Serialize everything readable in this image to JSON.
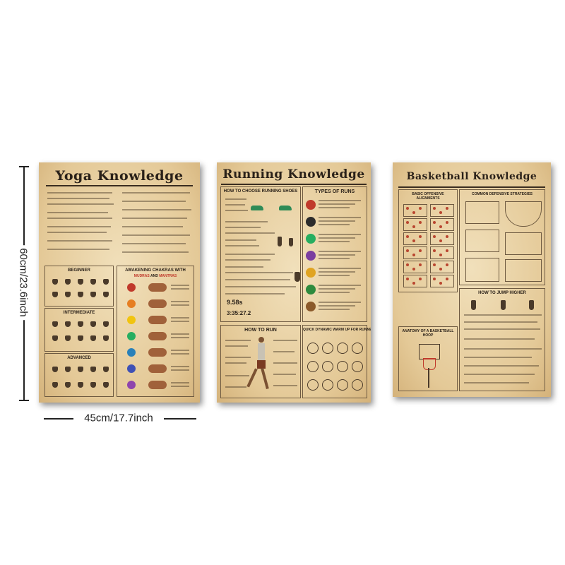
{
  "dimensions": {
    "height": "60cm/23.6inch",
    "width": "45cm/17.7inch"
  },
  "posters": {
    "yoga": {
      "title": "Yoga Knowledge",
      "sections": [
        "BEGINNER",
        "INTERMEDIATE",
        "ADVANCED"
      ],
      "chakras_title": "AWAKENING CHAKRAS WITH",
      "chakras_sub1": "MUDRAS",
      "chakras_and": "AND",
      "chakras_sub2": "MANTRAS"
    },
    "running": {
      "title": "Running Knowledge",
      "sections": {
        "shoes": "HOW TO CHOOSE RUNNING SHOES",
        "types": "TYPES OF RUNS",
        "how": "HOW TO RUN",
        "warmup": "QUICK DYNAMIC WARM UP FOR RUNNERS"
      },
      "stats": [
        "9.58s",
        "3:35:27.2"
      ]
    },
    "basketball": {
      "title": "Basketball Knowledge",
      "sections": {
        "offensive": "BASIC OFFENSIVE ALIGNMENTS",
        "defense": "COMMON DEFENSIVE STRATEGIES",
        "jump": "HOW TO JUMP HIGHER",
        "hoop": "ANATOMY OF A BASKETBALL HOOP"
      }
    }
  },
  "colors": {
    "paper": "#e9d3a6",
    "ink": "#2a2119",
    "chakras": [
      "#c0392b",
      "#e67e22",
      "#f1c40f",
      "#27ae60",
      "#2980b9",
      "#3f51b5",
      "#8e44ad"
    ],
    "runs": [
      "#c0392b",
      "#2c2c2c",
      "#27ae60",
      "#7b3fa0",
      "#e0a422",
      "#2e8b3e",
      "#8b5a2b"
    ]
  }
}
